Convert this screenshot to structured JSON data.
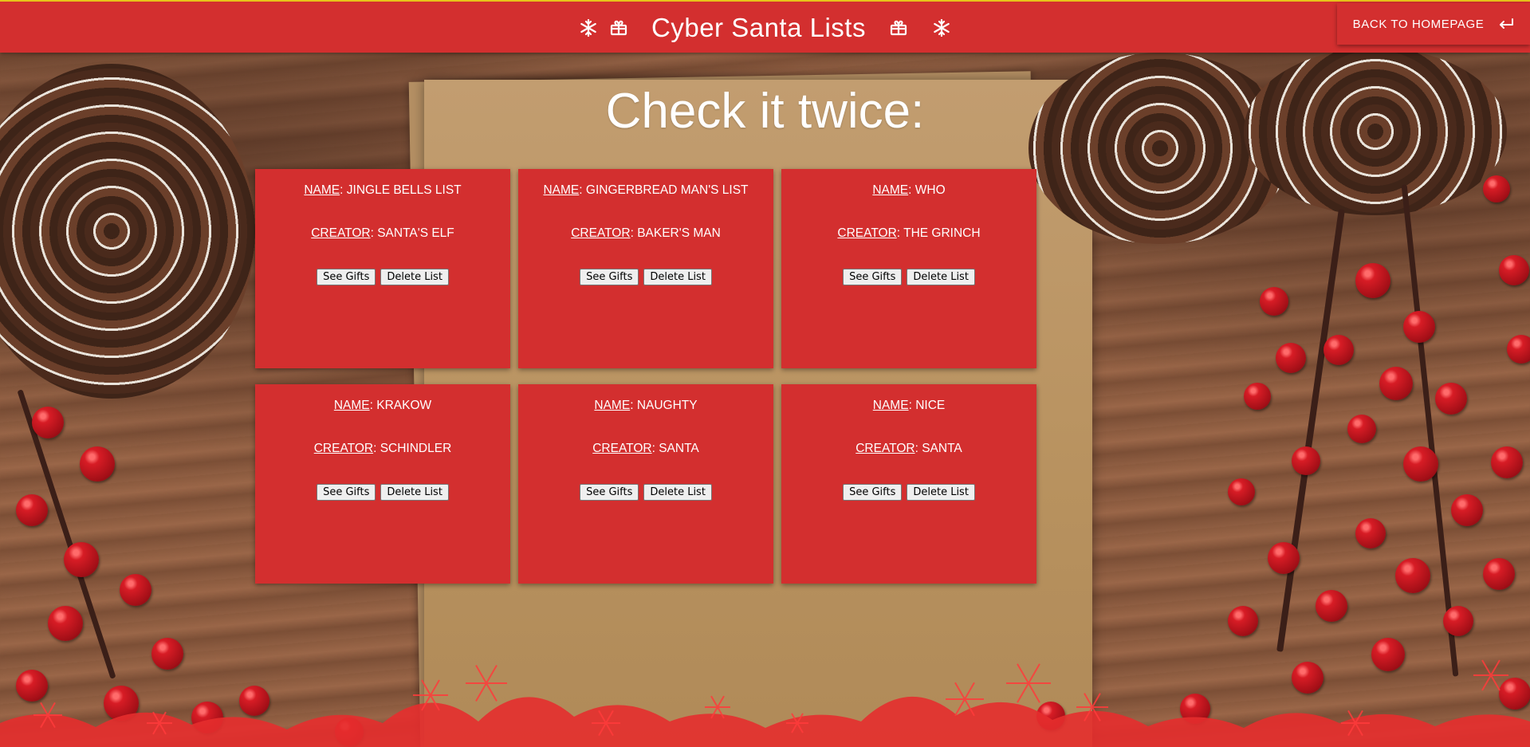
{
  "header": {
    "title": "Cyber Santa Lists",
    "back_button_label": "BACK TO HOMEPAGE"
  },
  "main": {
    "heading": "Check it twice:"
  },
  "lists": [
    {
      "name_label": "NAME",
      "name": "JINGLE BELLS LIST",
      "creator_label": "CREATOR",
      "creator": "SANTA'S ELF",
      "see_gifts_label": "See Gifts",
      "delete_label": "Delete List"
    },
    {
      "name_label": "NAME",
      "name": "GINGERBREAD MAN'S LIST",
      "creator_label": "CREATOR",
      "creator": "BAKER'S MAN",
      "see_gifts_label": "See Gifts",
      "delete_label": "Delete List"
    },
    {
      "name_label": "NAME",
      "name": "WHO",
      "creator_label": "CREATOR",
      "creator": "THE GRINCH",
      "see_gifts_label": "See Gifts",
      "delete_label": "Delete List"
    },
    {
      "name_label": "NAME",
      "name": "KRAKOW",
      "creator_label": "CREATOR",
      "creator": "SCHINDLER",
      "see_gifts_label": "See Gifts",
      "delete_label": "Delete List"
    },
    {
      "name_label": "NAME",
      "name": "NAUGHTY",
      "creator_label": "CREATOR",
      "creator": "SANTA",
      "see_gifts_label": "See Gifts",
      "delete_label": "Delete List"
    },
    {
      "name_label": "NAME",
      "name": "NICE",
      "creator_label": "CREATOR",
      "creator": "SANTA",
      "see_gifts_label": "See Gifts",
      "delete_label": "Delete List"
    }
  ],
  "theme": {
    "primary_red": "#d32f2f",
    "header_top_border": "#e7c21a",
    "text_color": "#ffffff"
  },
  "icons": {
    "header_left_outer": "snowflake-icon",
    "header_left_inner": "gift-icon",
    "header_right_inner": "gift-icon",
    "header_right_outer": "snowflake-icon",
    "back_button": "return-arrow-icon"
  }
}
